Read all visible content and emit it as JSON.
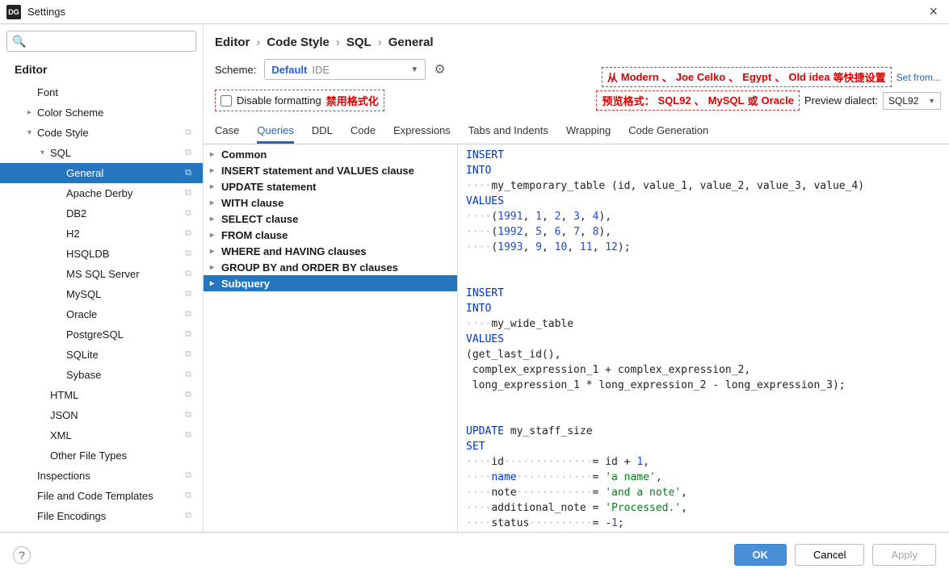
{
  "window": {
    "logo": "DG",
    "title": "Settings",
    "close": "×"
  },
  "search": {
    "placeholder": "",
    "icon": "🔍"
  },
  "tree": {
    "title": "Editor",
    "items": [
      {
        "label": "Font",
        "level": 1,
        "arrow": "",
        "copy": false
      },
      {
        "label": "Color Scheme",
        "level": 1,
        "arrow": "▸",
        "copy": false
      },
      {
        "label": "Code Style",
        "level": 1,
        "arrow": "▾",
        "copy": true
      },
      {
        "label": "SQL",
        "level": 2,
        "arrow": "▾",
        "copy": true
      },
      {
        "label": "General",
        "level": 3,
        "arrow": "",
        "copy": true,
        "selected": true
      },
      {
        "label": "Apache Derby",
        "level": 3,
        "arrow": "",
        "copy": true
      },
      {
        "label": "DB2",
        "level": 3,
        "arrow": "",
        "copy": true
      },
      {
        "label": "H2",
        "level": 3,
        "arrow": "",
        "copy": true
      },
      {
        "label": "HSQLDB",
        "level": 3,
        "arrow": "",
        "copy": true
      },
      {
        "label": "MS SQL Server",
        "level": 3,
        "arrow": "",
        "copy": true
      },
      {
        "label": "MySQL",
        "level": 3,
        "arrow": "",
        "copy": true
      },
      {
        "label": "Oracle",
        "level": 3,
        "arrow": "",
        "copy": true
      },
      {
        "label": "PostgreSQL",
        "level": 3,
        "arrow": "",
        "copy": true
      },
      {
        "label": "SQLite",
        "level": 3,
        "arrow": "",
        "copy": true
      },
      {
        "label": "Sybase",
        "level": 3,
        "arrow": "",
        "copy": true
      },
      {
        "label": "HTML",
        "level": 2,
        "arrow": "",
        "copy": true
      },
      {
        "label": "JSON",
        "level": 2,
        "arrow": "",
        "copy": true
      },
      {
        "label": "XML",
        "level": 2,
        "arrow": "",
        "copy": true
      },
      {
        "label": "Other File Types",
        "level": 2,
        "arrow": "",
        "copy": false
      },
      {
        "label": "Inspections",
        "level": 1,
        "arrow": "",
        "copy": true
      },
      {
        "label": "File and Code Templates",
        "level": 1,
        "arrow": "",
        "copy": true
      },
      {
        "label": "File Encodings",
        "level": 1,
        "arrow": "",
        "copy": true
      }
    ]
  },
  "breadcrumb": [
    "Editor",
    "Code Style",
    "SQL",
    "General"
  ],
  "scheme": {
    "label": "Scheme:",
    "name": "Default",
    "tag": "IDE",
    "gear": "⚙"
  },
  "disable_fmt": {
    "label": "Disable formatting",
    "annot": "禁用格式化"
  },
  "top_annot": {
    "prefix": "从",
    "parts": [
      "Modern",
      "Joe Celko",
      "Egypt",
      "Old idea"
    ],
    "suffix": "等快捷设置",
    "link": "Set from..."
  },
  "preview_row": {
    "prefix": "预览格式：",
    "parts": [
      "SQL92",
      "MySQL",
      "Oracle"
    ],
    "or": "或",
    "label": "Preview dialect:",
    "value": "SQL92"
  },
  "tabs": [
    "Case",
    "Queries",
    "DDL",
    "Code",
    "Expressions",
    "Tabs and Indents",
    "Wrapping",
    "Code Generation"
  ],
  "active_tab": 1,
  "options": [
    {
      "label": "Common"
    },
    {
      "label": "INSERT statement and VALUES clause"
    },
    {
      "label": "UPDATE statement"
    },
    {
      "label": "WITH clause"
    },
    {
      "label": "SELECT clause"
    },
    {
      "label": "FROM clause"
    },
    {
      "label": "WHERE and HAVING clauses"
    },
    {
      "label": "GROUP BY and ORDER BY clauses"
    },
    {
      "label": "Subquery",
      "selected": true
    }
  ],
  "code": "<span class='kw'>INSERT</span>\n<span class='kw'>INTO</span>\n<span class='dots'>····</span>my_temporary_table (id, value_1, value_2, value_3, value_4)\n<span class='kw'>VALUES</span>\n<span class='dots'>····</span>(<span class='num'>1991</span>, <span class='num'>1</span>, <span class='num'>2</span>, <span class='num'>3</span>, <span class='num'>4</span>),\n<span class='dots'>····</span>(<span class='num'>1992</span>, <span class='num'>5</span>, <span class='num'>6</span>, <span class='num'>7</span>, <span class='num'>8</span>),\n<span class='dots'>····</span>(<span class='num'>1993</span>, <span class='num'>9</span>, <span class='num'>10</span>, <span class='num'>11</span>, <span class='num'>12</span>);\n\n\n<span class='kw'>INSERT</span>\n<span class='kw'>INTO</span>\n<span class='dots'>····</span>my_wide_table\n<span class='kw'>VALUES</span>\n(get_last_id(),\n complex_expression_1 + complex_expression_2,\n long_expression_1 * long_expression_2 - long_expression_3);\n\n\n<span class='kw'>UPDATE</span> my_staff_size\n<span class='kw'>SET</span>\n<span class='dots'>····</span>id<span class='dots'>··············</span>= id + <span class='num'>1</span>,\n<span class='dots'>····</span><span class='kw'>name</span><span class='dots'>············</span>= <span class='str'>'a name'</span>,\n<span class='dots'>····</span>note<span class='dots'>············</span>= <span class='str'>'and a note'</span>,\n<span class='dots'>····</span>additional_note = <span class='str'>'Processed.'</span>,\n<span class='dots'>····</span>status<span class='dots'>··········</span>= -<span class='num'>1</span>;",
  "footer": {
    "help": "?",
    "ok": "OK",
    "cancel": "Cancel",
    "apply": "Apply"
  }
}
